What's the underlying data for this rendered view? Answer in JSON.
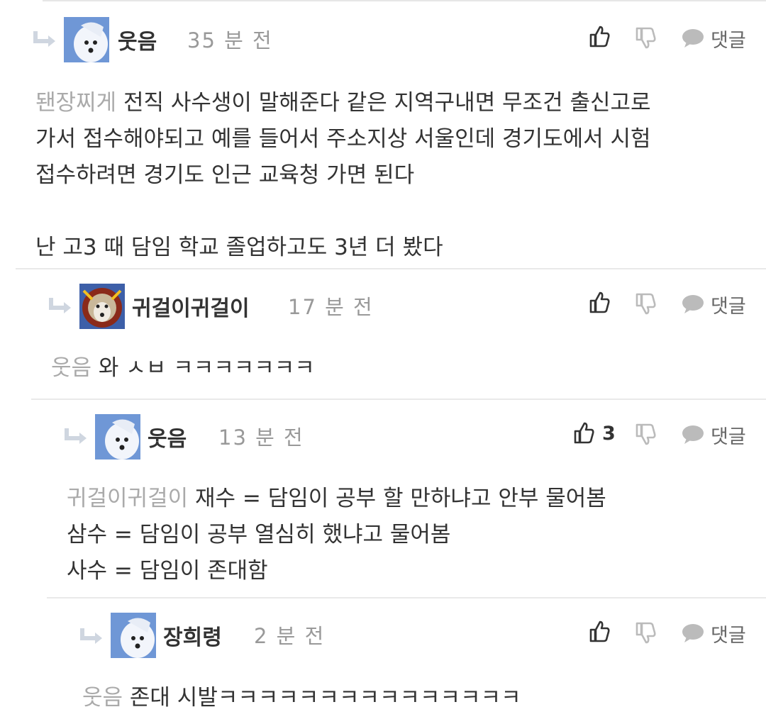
{
  "comments": [
    {
      "author": "웃음",
      "time": "35 분 전",
      "mention": "됀장찌게",
      "lines": [
        "전직 사수생이 말해준다 같은 지역구내면 무조건 출신고로",
        "가서 접수해야되고 예를 들어서 주소지상 서울인데 경기도에서 시험",
        "접수하려면 경기도 인근 교육청 가면 된다",
        "",
        "난 고3 때 담임 학교 졸업하고도 3년 더 봤다"
      ],
      "like_count": "",
      "reply_label": "댓글",
      "avatar": "white-dog"
    },
    {
      "author": "귀걸이귀걸이",
      "time": "17 분 전",
      "mention": "웃음",
      "lines": [
        "와 ㅅㅂ ㅋㅋㅋㅋㅋㅋㅋ"
      ],
      "like_count": "",
      "reply_label": "댓글",
      "avatar": "lion"
    },
    {
      "author": "웃음",
      "time": "13 분 전",
      "mention": "귀걸이귀걸이",
      "lines": [
        "재수 = 담임이 공부 할 만하냐고 안부 물어봄",
        "삼수 = 담임이 공부 열심히 했냐고 물어봄",
        "사수 = 담임이 존대함"
      ],
      "like_count": "3",
      "reply_label": "댓글",
      "avatar": "white-dog"
    },
    {
      "author": "장희령",
      "time": "2 분 전",
      "mention": "웃음",
      "lines": [
        "존대 시발ㅋㅋㅋㅋㅋㅋㅋㅋㅋㅋㅋㅋㅋㅋㅋ"
      ],
      "like_count": "",
      "reply_label": "댓글",
      "avatar": "white-dog"
    }
  ],
  "colors": {
    "text": "#333333",
    "muted": "#999999",
    "mention": "#aaaaaa",
    "icon": "#333333",
    "icon_muted": "#bbbbbb",
    "divider": "#e9e9e9"
  }
}
